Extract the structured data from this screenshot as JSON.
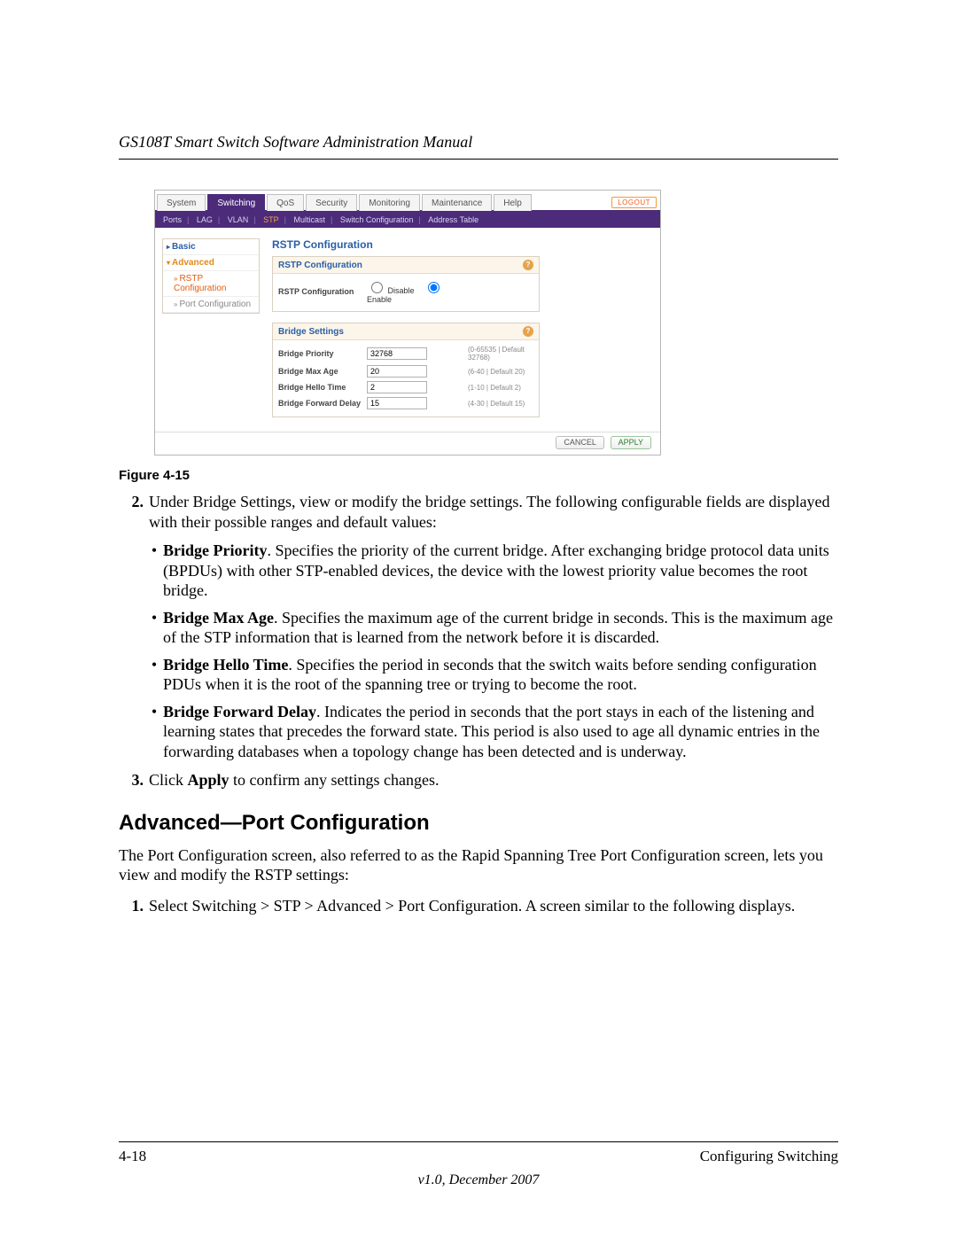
{
  "doc": {
    "running_header": "GS108T Smart Switch Software Administration Manual",
    "figure_caption": "Figure 4-15",
    "footer_left": "4-18",
    "footer_right": "Configuring Switching",
    "version_line": "v1.0, December 2007",
    "section_heading": "Advanced—Port Configuration"
  },
  "ui": {
    "tabs": [
      "System",
      "Switching",
      "QoS",
      "Security",
      "Monitoring",
      "Maintenance",
      "Help"
    ],
    "active_tab_index": 1,
    "logout_label": "LOGOUT",
    "subnav_items": [
      "Ports",
      "LAG",
      "VLAN",
      "STP",
      "Multicast",
      "Switch Configuration",
      "Address Table"
    ],
    "subnav_active_index": 3,
    "sidenav": {
      "basic_label": "Basic",
      "advanced_label": "Advanced",
      "item_rstp": "RSTP Configuration",
      "item_portconf": "Port Configuration"
    },
    "page_title": "RSTP Configuration",
    "panel_rstp": {
      "header": "RSTP Configuration",
      "row_label": "RSTP Configuration",
      "radio_disable": "Disable",
      "radio_enable": "Enable"
    },
    "panel_bridge": {
      "header": "Bridge Settings",
      "rows": [
        {
          "label": "Bridge Priority",
          "value": "32768",
          "hint": "(0-65535 | Default 32768)"
        },
        {
          "label": "Bridge Max Age",
          "value": "20",
          "hint": "(6-40 | Default 20)"
        },
        {
          "label": "Bridge Hello Time",
          "value": "2",
          "hint": "(1-10 | Default 2)"
        },
        {
          "label": "Bridge Forward Delay",
          "value": "15",
          "hint": "(4-30 | Default 15)"
        }
      ]
    },
    "footer_buttons": {
      "cancel": "CANCEL",
      "apply": "APPLY"
    }
  },
  "body": {
    "step2_num": "2.",
    "step2_text": "Under Bridge Settings, view or modify the bridge settings. The following configurable fields are displayed with their possible ranges and default values:",
    "bullets": [
      {
        "term": "Bridge Priority",
        "desc": ". Specifies the priority of the current bridge. After exchanging bridge protocol data units (BPDUs) with other STP-enabled devices, the device with the lowest priority value becomes the root bridge."
      },
      {
        "term": "Bridge Max Age",
        "desc": ". Specifies the maximum age of the current bridge in seconds. This is the maximum age of the STP information that is learned from the network before it is discarded."
      },
      {
        "term": "Bridge Hello Time",
        "desc": ". Specifies the period in seconds that the switch waits before sending configuration PDUs when it is the root of the spanning tree or trying to become the root."
      },
      {
        "term": "Bridge Forward Delay",
        "desc": ". Indicates the period in seconds that the port stays in each of the listening and learning states that precedes the forward state. This period is also used to age all dynamic entries in the forwarding databases when a topology change has been detected and is underway."
      }
    ],
    "step3_num": "3.",
    "step3_pre": "Click ",
    "step3_bold": "Apply",
    "step3_post": " to confirm any settings changes.",
    "para2": "The Port Configuration screen, also referred to as the Rapid Spanning Tree Port Configuration screen, lets you view and modify the RSTP settings:",
    "step1b_num": "1.",
    "step1b_text": "Select Switching > STP > Advanced > Port Configuration. A screen similar to the following displays."
  }
}
